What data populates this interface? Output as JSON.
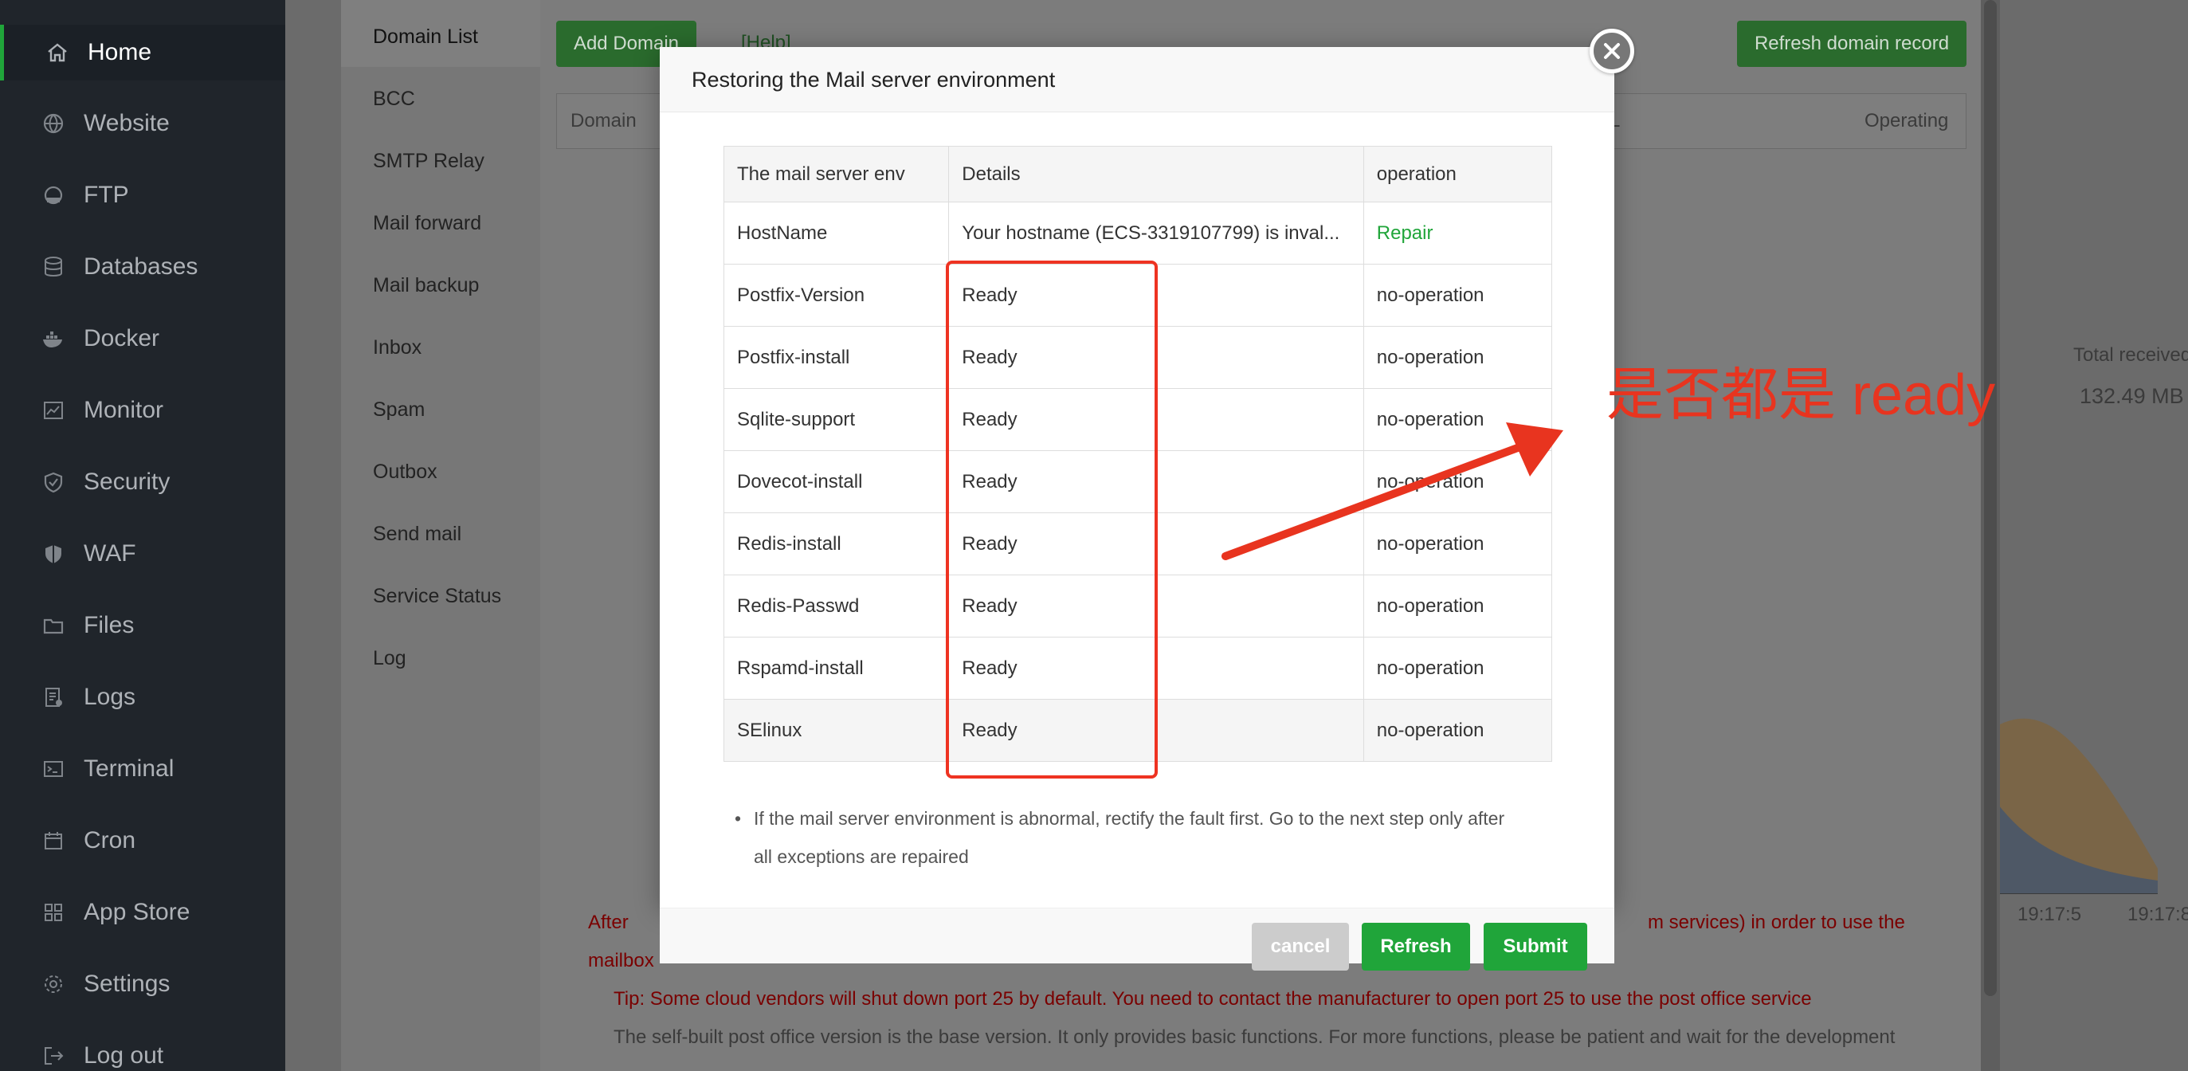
{
  "sidebar": {
    "items": [
      {
        "label": "Home",
        "icon": "home-icon"
      },
      {
        "label": "Website",
        "icon": "globe-icon"
      },
      {
        "label": "FTP",
        "icon": "ftp-icon"
      },
      {
        "label": "Databases",
        "icon": "database-icon"
      },
      {
        "label": "Docker",
        "icon": "docker-icon"
      },
      {
        "label": "Monitor",
        "icon": "monitor-icon"
      },
      {
        "label": "Security",
        "icon": "shield-icon"
      },
      {
        "label": "WAF",
        "icon": "waf-shield-icon"
      },
      {
        "label": "Files",
        "icon": "folder-icon"
      },
      {
        "label": "Logs",
        "icon": "logs-icon"
      },
      {
        "label": "Terminal",
        "icon": "terminal-icon"
      },
      {
        "label": "Cron",
        "icon": "calendar-icon"
      },
      {
        "label": "App Store",
        "icon": "apps-icon"
      },
      {
        "label": "Settings",
        "icon": "gear-icon"
      },
      {
        "label": "Log out",
        "icon": "logout-icon"
      }
    ]
  },
  "plugin_menu": {
    "items": [
      "Domain List",
      "BCC",
      "SMTP Relay",
      "Mail forward",
      "Mail backup",
      "Inbox",
      "Spam",
      "Outbox",
      "Send mail",
      "Service Status",
      "Log"
    ]
  },
  "background": {
    "add_domain": "Add Domain",
    "help": "[Help]",
    "refresh_domain_record": "Refresh domain record",
    "table_domain": "Domain",
    "table_l": "L",
    "table_operating": "Operating",
    "total_received_label": "Total received",
    "total_received_value": "132.49 MB",
    "chart_tick_1": "19:17:5",
    "chart_tick_2": "19:17:8",
    "notice_1a": "After",
    "notice_1b": "m services) in order to use the",
    "notice_1c": "mailbox",
    "notice_2": "Tip: Some cloud vendors will shut down port 25 by default. You need to contact the manufacturer to open port 25 to use the post office service",
    "notice_3": "The self-built post office version is the base version. It only provides basic functions. For more functions, please be patient and wait for the development"
  },
  "modal": {
    "title": "Restoring the Mail server environment",
    "columns": [
      "The mail server env",
      "Details",
      "operation"
    ],
    "rows": [
      {
        "env": "HostName",
        "details": "Your hostname (ECS-3319107799) is inval...",
        "operation": "Repair"
      },
      {
        "env": "Postfix-Version",
        "details": "Ready",
        "operation": "no-operation"
      },
      {
        "env": "Postfix-install",
        "details": "Ready",
        "operation": "no-operation"
      },
      {
        "env": "Sqlite-support",
        "details": "Ready",
        "operation": "no-operation"
      },
      {
        "env": "Dovecot-install",
        "details": "Ready",
        "operation": "no-operation"
      },
      {
        "env": "Redis-install",
        "details": "Ready",
        "operation": "no-operation"
      },
      {
        "env": "Redis-Passwd",
        "details": "Ready",
        "operation": "no-operation"
      },
      {
        "env": "Rspamd-install",
        "details": "Ready",
        "operation": "no-operation"
      },
      {
        "env": "SElinux",
        "details": "Ready",
        "operation": "no-operation"
      }
    ],
    "note": "If the mail server environment is abnormal, rectify the fault first. Go to the next step only after all exceptions are repaired",
    "cancel_label": "cancel",
    "refresh_label": "Refresh",
    "submit_label": "Submit"
  },
  "annotation": {
    "text": "是否都是 ready",
    "color": "#e8341f"
  },
  "colors": {
    "accent_green": "#20a53a",
    "error_red": "#ee0000",
    "sidebar_bg": "#20252b"
  }
}
